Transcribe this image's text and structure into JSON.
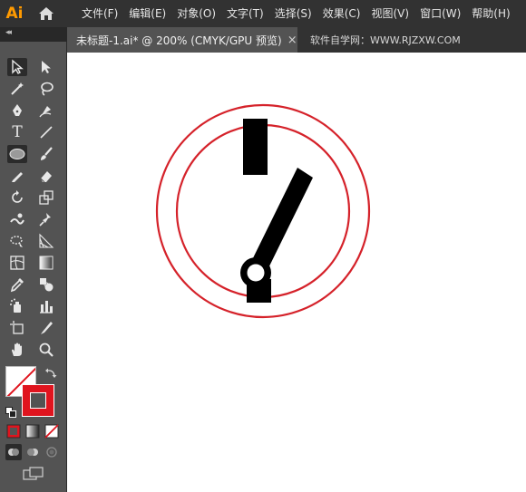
{
  "app": {
    "logo": "Ai"
  },
  "menu": {
    "items": [
      {
        "label": "文件(F)",
        "name": "menu-file"
      },
      {
        "label": "编辑(E)",
        "name": "menu-edit"
      },
      {
        "label": "对象(O)",
        "name": "menu-object"
      },
      {
        "label": "文字(T)",
        "name": "menu-type"
      },
      {
        "label": "选择(S)",
        "name": "menu-select"
      },
      {
        "label": "效果(C)",
        "name": "menu-effect"
      },
      {
        "label": "视图(V)",
        "name": "menu-view"
      },
      {
        "label": "窗口(W)",
        "name": "menu-window"
      },
      {
        "label": "帮助(H)",
        "name": "menu-help"
      }
    ]
  },
  "tabs": {
    "document": "未标题-1.ai* @ 200% (CMYK/GPU 预览)",
    "close_symbol": "×",
    "watermark": "软件自学网：WWW.RJZXW.COM"
  },
  "toolbar": {
    "collapse_symbol": "◂◂",
    "type_tool_glyph": "T",
    "active_tool": "selection-tool"
  },
  "colors": {
    "menubar_bg": "#323232",
    "toolbar_bg": "#535353",
    "canvas_bg": "#ffffff",
    "fill": "none",
    "stroke": "#e0141e",
    "artwork_black": "#000000",
    "circle_stroke": "#d5222a"
  }
}
